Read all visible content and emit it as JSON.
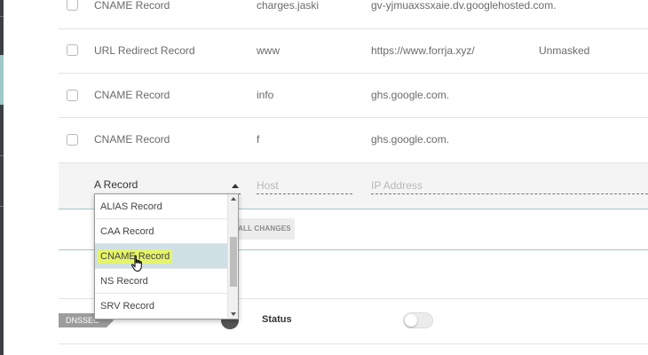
{
  "records": [
    {
      "type": "CNAME Record",
      "host": "charges.jaski",
      "value": "gv-yjmuaxssxaie.dv.googlehosted.com.",
      "extra": ""
    },
    {
      "type": "URL Redirect Record",
      "host": "www",
      "value": "https://www.forrja.xyz/",
      "extra": "Unmasked"
    },
    {
      "type": "CNAME Record",
      "host": "info",
      "value": "ghs.google.com.",
      "extra": ""
    },
    {
      "type": "CNAME Record",
      "host": "f",
      "value": "ghs.google.com.",
      "extra": ""
    }
  ],
  "edit_row": {
    "type_select_value": "A Record",
    "host_placeholder": "Host",
    "ip_placeholder": "IP Address"
  },
  "dropdown": {
    "options": [
      "ALIAS Record",
      "CAA Record",
      "CNAME Record",
      "NS Record",
      "SRV Record"
    ],
    "selected_index": 2,
    "highlight_color": "#e5f46a"
  },
  "actions": {
    "save_all_label": "ALL CHANGES"
  },
  "dnssec": {
    "tag_label": "DNSSEC",
    "status_label": "Status",
    "enabled": false
  },
  "colors": {
    "accent": "#9fc9c6",
    "selected_option_bg": "#cfe0e5"
  }
}
